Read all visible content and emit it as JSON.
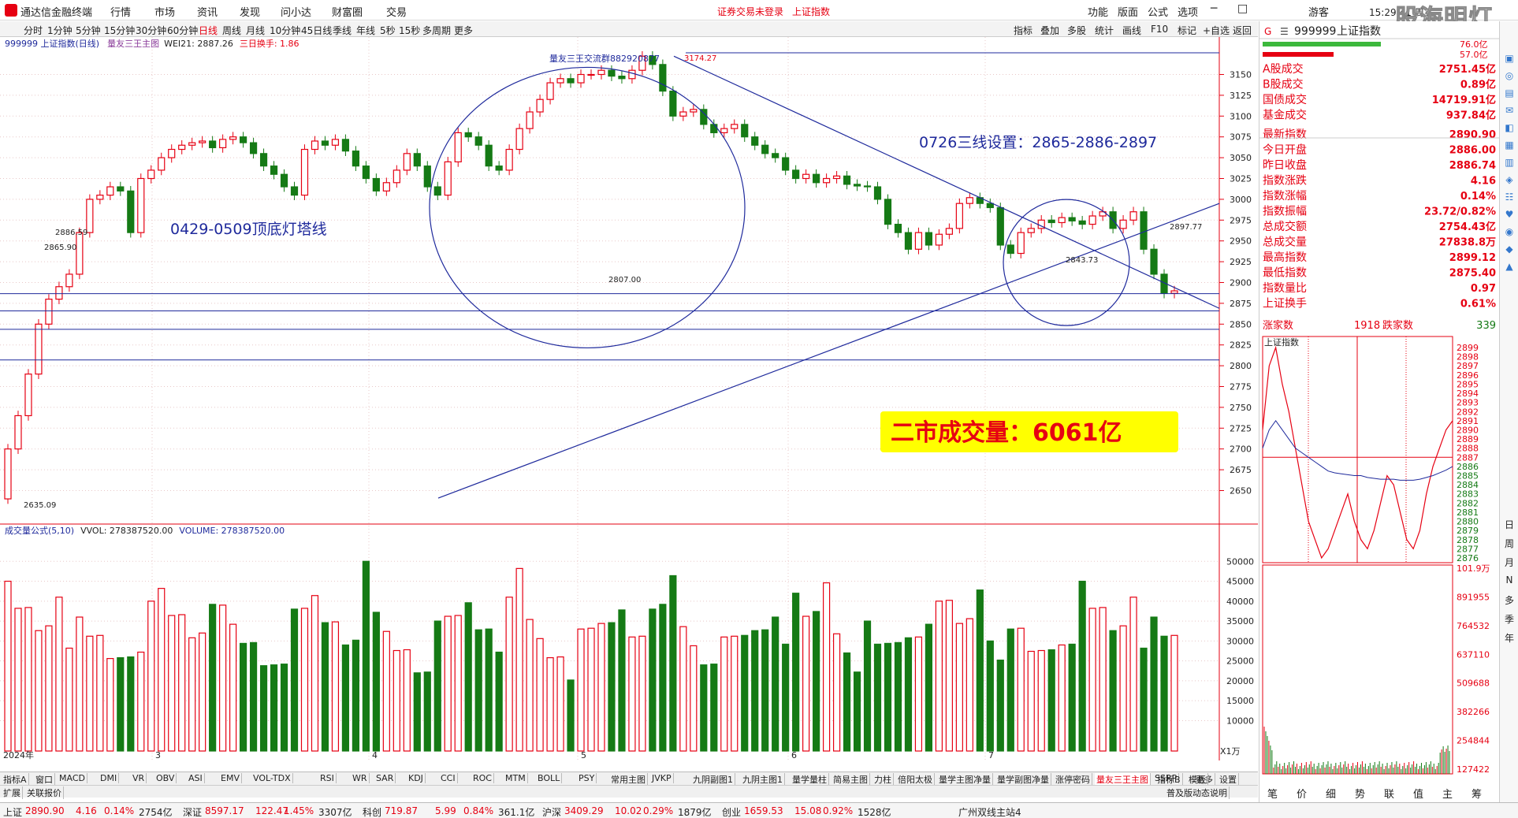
{
  "title_bar": {
    "app": "通达信金融终端",
    "menus": [
      "行情",
      "市场",
      "资讯",
      "发现",
      "问小达",
      "财富圈",
      "交易"
    ],
    "notice": "证券交易未登录",
    "notice2": "上证指数",
    "right_menus": [
      "功能",
      "版面",
      "公式",
      "选项"
    ],
    "guest": "游客",
    "time": "15:29:41 周五",
    "watermark": "股海明灯"
  },
  "period_bar": {
    "items": [
      "分时",
      "1分钟",
      "5分钟",
      "15分钟",
      "30分钟",
      "60分钟",
      "日线",
      "周线",
      "月线",
      "10分钟",
      "45日线",
      "季线",
      "年线",
      "5秒",
      "15秒",
      "多周期",
      "更多"
    ],
    "selected": "日线"
  },
  "toolbar_right": [
    "指标",
    "叠加",
    "多股",
    "统计",
    "画线",
    "F10",
    "标记",
    "+自选",
    "返回"
  ],
  "info_line": {
    "a": "999999 上证指数(日线)",
    "b": "量友三王主图",
    "c": "WEI21: 2887.26",
    "d": "三日换手: 1.86"
  },
  "volume_info": {
    "a": "成交量公式(5,10)",
    "b": "VVOL: 278387520.00",
    "c": "VOLUME: 278387520.00"
  },
  "price_axis": [
    "3150",
    "3125",
    "3100",
    "3075",
    "3050",
    "3025",
    "3000",
    "2975",
    "2950",
    "2925",
    "2900",
    "2875",
    "2850",
    "2825",
    "2800",
    "2775",
    "2750",
    "2725",
    "2700",
    "2675",
    "2650"
  ],
  "volume_axis": [
    "50000",
    "45000",
    "40000",
    "35000",
    "30000",
    "25000",
    "20000",
    "15000",
    "10000"
  ],
  "volume_unit": "X1万",
  "month_labels": [
    "2024年",
    "3",
    "4",
    "5",
    "6",
    "7"
  ],
  "annotations": {
    "group": "量友三王交流群882920877",
    "tl": "0429-0509顶底灯塔线",
    "tr": "0726三线设置：2865-2886-2897",
    "big": "二市成交量：6061亿",
    "p3174": "3174.27",
    "p2886": "2886.59",
    "p2865": "2865.90",
    "p2807": "2807.00",
    "p2843": "2843.73",
    "p2897": "2897.77",
    "p2635": "2635.09"
  },
  "tabs": [
    "指标A",
    "窗口",
    "MACD",
    "DMI",
    "VR",
    "OBV",
    "ASI",
    "EMV",
    "VOL-TDX",
    "RSI",
    "WR",
    "SAR",
    "KDJ",
    "CCI",
    "ROC",
    "MTM",
    "BOLL",
    "PSY",
    "常用主图",
    "JVKP",
    "九阴副图1",
    "九阴主图1",
    "量学量柱",
    "简易主图",
    "力柱",
    "倍阳太极",
    "量学主图净量",
    "量学副图净量",
    "涨停密码",
    "量友三王主图",
    "SSRP",
    "更多",
    "设置"
  ],
  "tabs_right": [
    "指标B",
    "模板"
  ],
  "tabs_row2": [
    "扩展",
    "关联报价"
  ],
  "tabs_row2_right": [
    "普及版动态说明"
  ],
  "quote_header": {
    "code": "999999",
    "name": "上证指数",
    "badge": "G"
  },
  "bars": {
    "up": "76.0亿",
    "down": "57.0亿"
  },
  "quote": [
    {
      "k": "A股成交",
      "v": "2751.45亿"
    },
    {
      "k": "B股成交",
      "v": "0.89亿"
    },
    {
      "k": "国债成交",
      "v": "14719.91亿"
    },
    {
      "k": "基金成交",
      "v": "937.84亿"
    },
    {
      "k": "最新指数",
      "v": "2890.90"
    },
    {
      "k": "今日开盘",
      "v": "2886.00"
    },
    {
      "k": "昨日收盘",
      "v": "2886.74"
    },
    {
      "k": "指数涨跌",
      "v": "4.16"
    },
    {
      "k": "指数涨幅",
      "v": "0.14%"
    },
    {
      "k": "指数振幅",
      "v": "23.72/0.82%"
    },
    {
      "k": "总成交额",
      "v": "2754.43亿"
    },
    {
      "k": "总成交量",
      "v": "27838.8万"
    },
    {
      "k": "最高指数",
      "v": "2899.12"
    },
    {
      "k": "最低指数",
      "v": "2875.40"
    },
    {
      "k": "指数量比",
      "v": "0.97"
    },
    {
      "k": "上证换手",
      "v": "0.61%"
    }
  ],
  "updown": {
    "up_label": "涨家数",
    "up": "1918",
    "down_label": "跌家数",
    "down": "339"
  },
  "intraday": {
    "title": "上证指数",
    "axis": [
      "2899",
      "2898",
      "2897",
      "2896",
      "2895",
      "2894",
      "2893",
      "2892",
      "2891",
      "2890",
      "2889",
      "2888",
      "2887",
      "2886",
      "2885",
      "2884",
      "2883",
      "2882",
      "2881",
      "2880",
      "2879",
      "2878",
      "2877",
      "2876"
    ],
    "vol_axis": [
      "101.9万",
      "891955",
      "764532",
      "637110",
      "509688",
      "382266",
      "254844",
      "127422"
    ],
    "ref": 2887,
    "hi": 2899,
    "lo": 2876
  },
  "right_tabs": [
    "笔",
    "价",
    "细",
    "势",
    "联",
    "值",
    "主",
    "筹"
  ],
  "sidebar": [
    "日",
    "周",
    "月",
    "N",
    "多",
    "季",
    "年"
  ],
  "status": [
    {
      "k": "上证",
      "v": "2890.90",
      "a": "4.16",
      "b": "0.14%",
      "c": "2754亿"
    },
    {
      "k": "深证",
      "v": "8597.17",
      "a": "122.47",
      "b": "1.45%",
      "c": "3307亿"
    },
    {
      "k": "科创",
      "v": "719.87",
      "a": "5.99",
      "b": "0.84%",
      "c": "361.1亿"
    },
    {
      "k": "沪深",
      "v": "3409.29",
      "a": "10.02",
      "b": "0.29%",
      "c": "1879亿"
    },
    {
      "k": "创业",
      "v": "1659.53",
      "a": "15.08",
      "b": "0.92%",
      "c": "1528亿"
    }
  ],
  "status_right": "广州双线主站4",
  "colors": {
    "up": "#e60012",
    "down": "#157a15",
    "line": "#1f2a9c",
    "accent_yellow": "#ffff00"
  }
}
